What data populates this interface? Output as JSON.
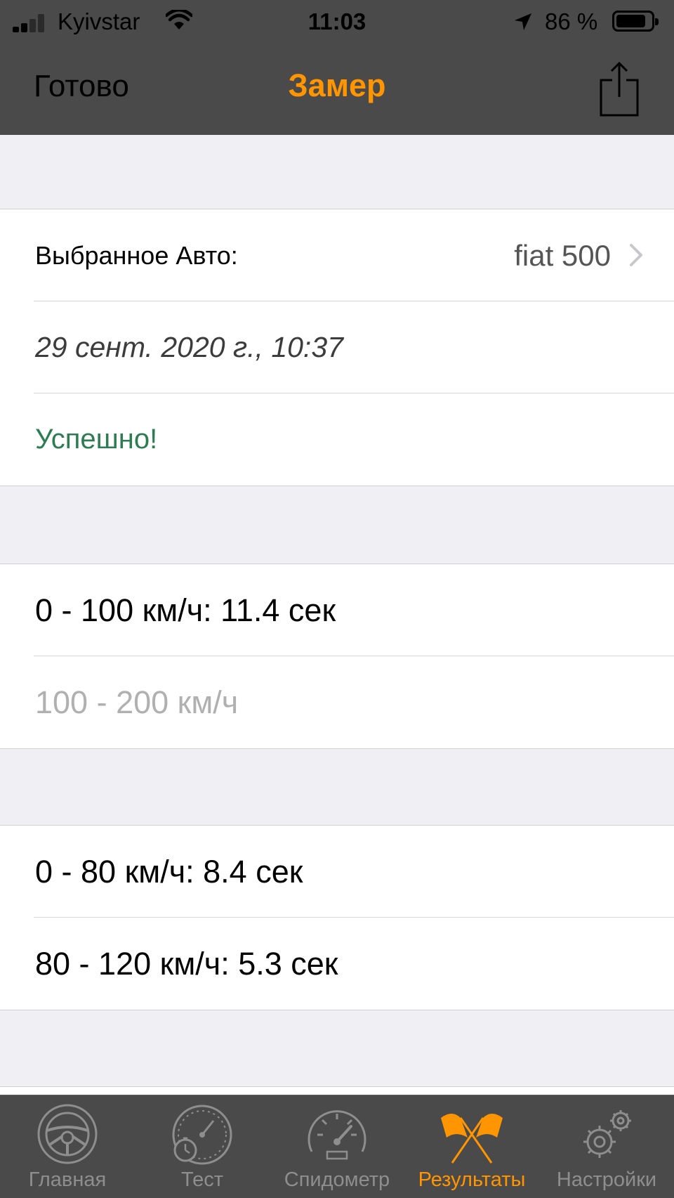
{
  "status_bar": {
    "carrier": "Kyivstar",
    "time": "11:03",
    "battery_percent": "86 %",
    "battery_level": 0.86
  },
  "nav": {
    "done_label": "Готово",
    "title": "Замер",
    "share_icon": "share-icon"
  },
  "info": {
    "car_label": "Выбранное Авто:",
    "car_value": "fiat  500",
    "date": "29 сент. 2020 г., 10:37",
    "status": "Успешно!"
  },
  "results_group1": [
    {
      "text": "0 - 100 км/ч: 11.4 сек",
      "measured": true
    },
    {
      "text": "100 - 200 км/ч",
      "measured": false
    }
  ],
  "results_group2": [
    {
      "text": "0 - 80 км/ч: 8.4 сек",
      "measured": true
    },
    {
      "text": "80 - 120 км/ч: 5.3 сек",
      "measured": true
    }
  ],
  "tabs": [
    {
      "label": "Главная",
      "icon": "steering-wheel-icon",
      "active": false
    },
    {
      "label": "Тест",
      "icon": "stopwatch-gauge-icon",
      "active": false
    },
    {
      "label": "Спидометр",
      "icon": "speedometer-icon",
      "active": false
    },
    {
      "label": "Результаты",
      "icon": "crossed-flags-icon",
      "active": true
    },
    {
      "label": "Настройки",
      "icon": "gears-icon",
      "active": false
    }
  ],
  "colors": {
    "accent": "#ff9500",
    "bar_background": "#4a4a4a",
    "success": "#2e7d52",
    "page_background": "#efeff4"
  }
}
